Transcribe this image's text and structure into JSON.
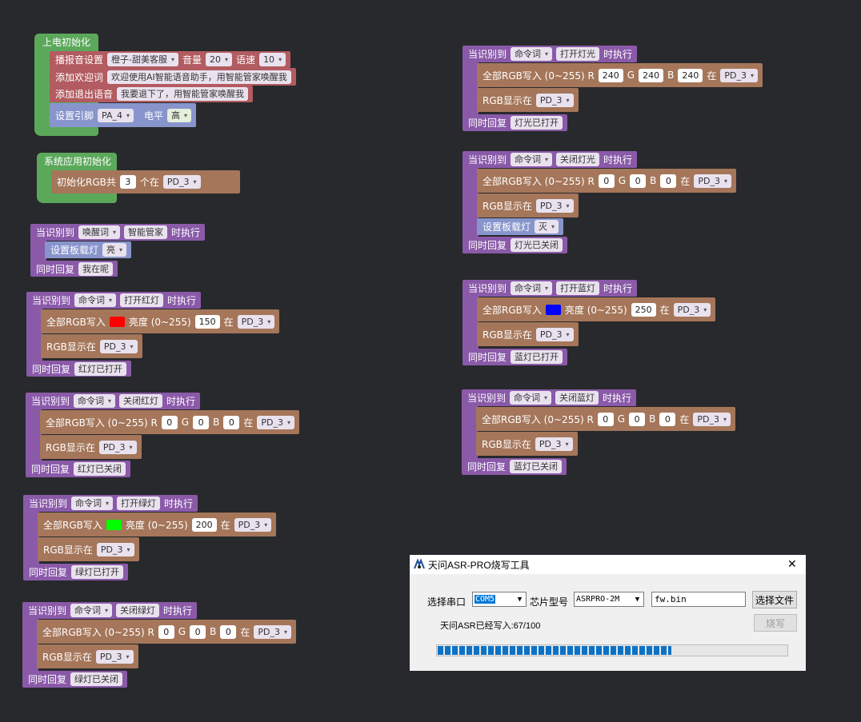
{
  "colors": {
    "red_swatch": "#ff0000",
    "green_swatch": "#00ff00",
    "blue_swatch": "#0000ff",
    "canvas_bg": "#28292c"
  },
  "labels": {
    "power_init": "上电初始化",
    "system_init": "系统应用初始化",
    "when_recognized": "当识别到",
    "then_execute": "时执行",
    "reply": "同时回复",
    "rgb_write_all": "全部RGB写入 (0~255) R",
    "rgb_write_bright": "全部RGB写入",
    "brightness": "亮度 (0~255)",
    "G": "G",
    "B": "B",
    "at": "在",
    "rgb_show_at": "RGB显示在",
    "set_onboard_led": "设置板载灯",
    "init_rgb": "初始化RGB共",
    "count_unit": "个在",
    "play_settings": "播报音设置",
    "volume": "音量",
    "speed": "语速",
    "add_welcome": "添加欢迎词",
    "add_exit": "添加退出语音",
    "set_pin": "设置引脚",
    "level": "电平"
  },
  "values": {
    "voice": "橙子-甜美客服",
    "volume": "20",
    "speed": "10",
    "welcome": "欢迎使用AI智能语音助手，用智能管家唤醒我",
    "exit": "我要退下了，用智能管家唤醒我",
    "pin": "PA_4",
    "pin_level": "高",
    "rgb_count": "3",
    "pin_pd3": "PD_3",
    "wake_type": "唤醒词",
    "cmd_type": "命令词",
    "wake_word": "智能管家",
    "led_on": "亮",
    "led_off": "灭",
    "zero": "0",
    "v240": "240",
    "v150": "150",
    "v200": "200",
    "v250": "250"
  },
  "commands": {
    "open_red": "打开红灯",
    "close_red": "关闭红灯",
    "open_green": "打开绿灯",
    "close_green": "关闭绿灯",
    "open_light": "打开灯光",
    "close_light": "关闭灯光",
    "open_blue": "打开蓝灯",
    "close_blue": "关闭蓝灯"
  },
  "replies": {
    "wake": "我在呢",
    "red_on": "红灯已打开",
    "red_off": "红灯已关闭",
    "green_on": "绿灯已打开",
    "green_off": "绿灯已关闭",
    "light_on": "灯光已打开",
    "light_off": "灯光已关闭",
    "blue_on": "蓝灯已打开",
    "blue_off": "蓝灯已关闭"
  },
  "dialog": {
    "title": "天问ASR-PRO烧写工具",
    "close": "✕",
    "port_label": "选择串口",
    "port_value": "COM5",
    "chip_label": "芯片型号",
    "chip_value": "ASRPRO-2M",
    "file_value": "fw.bin",
    "choose_file": "选择文件",
    "burn": "烧写",
    "status": "天问ASR已经写入:67/100",
    "progress": 0.67
  }
}
